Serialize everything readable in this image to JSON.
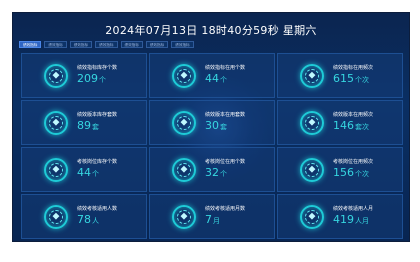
{
  "header": {
    "title": "2024年07月13日 18时40分59秒 星期六"
  },
  "tabs": [
    {
      "label": "绩效指标",
      "active": true
    },
    {
      "label": "绩效指标"
    },
    {
      "label": "绩效指标"
    },
    {
      "label": "绩效指标"
    },
    {
      "label": "绩效指标"
    },
    {
      "label": "绩效指标"
    },
    {
      "label": "绩效指标"
    }
  ],
  "cards": [
    {
      "label": "绩效指标库存个数",
      "value": "209",
      "unit": "个",
      "icon": "diamond-icon"
    },
    {
      "label": "绩效指标在用个数",
      "value": "44",
      "unit": "个",
      "icon": "diamond-icon"
    },
    {
      "label": "绩效指标在用频次",
      "value": "615",
      "unit": "个次",
      "icon": "diamond-icon"
    },
    {
      "label": "绩效版本库存套数",
      "value": "89",
      "unit": "套",
      "icon": "diamond-icon"
    },
    {
      "label": "绩效版本在用套数",
      "value": "30",
      "unit": "套",
      "icon": "diamond-icon"
    },
    {
      "label": "绩效版本在用频次",
      "value": "146",
      "unit": "套次",
      "icon": "diamond-icon"
    },
    {
      "label": "考核岗位库存个数",
      "value": "44",
      "unit": "个",
      "icon": "diamond-icon"
    },
    {
      "label": "考核岗位在用个数",
      "value": "32",
      "unit": "个",
      "icon": "diamond-icon"
    },
    {
      "label": "考核岗位在用频次",
      "value": "156",
      "unit": "个次",
      "icon": "diamond-icon"
    },
    {
      "label": "绩效考核适用人数",
      "value": "78",
      "unit": "人",
      "icon": "diamond-icon"
    },
    {
      "label": "绩效考核适用月数",
      "value": "7",
      "unit": "月",
      "icon": "diamond-icon"
    },
    {
      "label": "绩效考核适用人月",
      "value": "419",
      "unit": "人月",
      "icon": "diamond-icon"
    }
  ],
  "colors": {
    "accent": "#36d6e0",
    "ring": "#1ecbd7",
    "background": "#0a2f63"
  }
}
